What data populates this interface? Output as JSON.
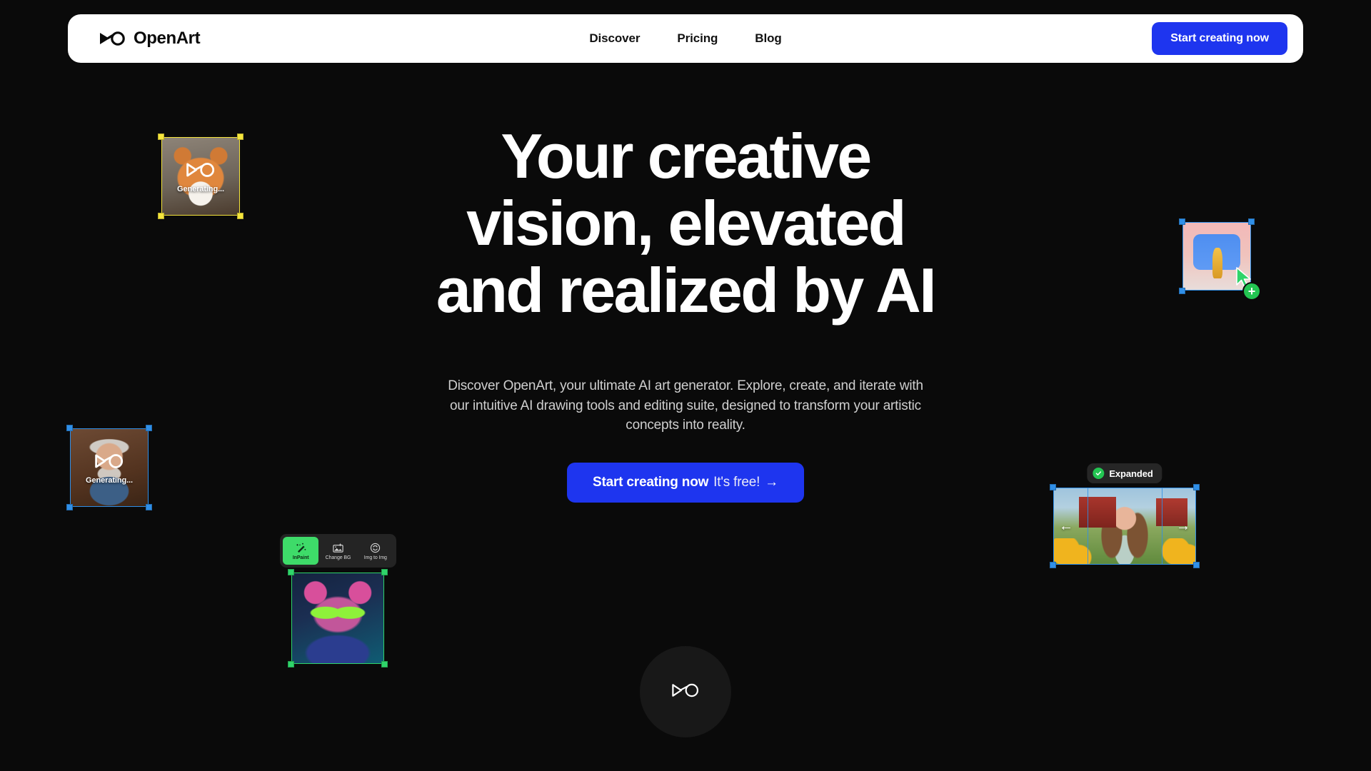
{
  "colors": {
    "background": "#0a0a0a",
    "header_bg": "#ffffff",
    "accent_blue": "#1e35ef",
    "accent_green": "#3edb69",
    "badge_green": "#23c552",
    "select_yellow": "#f5e53c",
    "select_blue": "#2f8fe8",
    "select_green": "#2fd46a"
  },
  "header": {
    "brand": "OpenArt",
    "logo_icon": "openart-infinity-icon",
    "nav": [
      {
        "label": "Discover"
      },
      {
        "label": "Pricing"
      },
      {
        "label": "Blog"
      }
    ],
    "cta_label": "Start creating now"
  },
  "hero": {
    "headline_line1": "Your creative",
    "headline_line2": "vision, elevated",
    "headline_line3": "and realized by AI",
    "subtitle": "Discover OpenArt, your ultimate AI art generator. Explore, create, and iterate with our intuitive AI drawing tools and editing suite, designed to transform your artistic concepts into reality.",
    "cta_bold": "Start creating now",
    "cta_light": "It's free!",
    "cta_arrow": "→"
  },
  "orb": {
    "icon": "openart-infinity-icon"
  },
  "cards": {
    "generating_cat": {
      "name": "generating-cat-card",
      "overlay_text": "Generating...",
      "overlay_icon": "openart-infinity-icon",
      "selection_color": "#f5e53c",
      "subject": "orange tabby cat"
    },
    "generating_man": {
      "name": "generating-old-man-card",
      "overlay_text": "Generating...",
      "overlay_icon": "openart-infinity-icon",
      "selection_color": "#2f8fe8",
      "subject": "elderly man 3d character"
    },
    "expand": {
      "name": "expand-canvas-card",
      "selection_color": "#2f8fe8",
      "cursor_icon": "cursor-arrow-icon",
      "plus_badge": "+",
      "subject": "image being outpainted"
    },
    "expanded": {
      "name": "expanded-result-card",
      "badge_label": "Expanded",
      "badge_icon": "check-circle-icon",
      "selection_color": "#2f8fe8",
      "arrow_left": "←",
      "arrow_right": "→",
      "subject": "girl with braids in farm scene"
    },
    "edit_tools": {
      "name": "edit-tools-card",
      "tools": [
        {
          "label": "InPaint",
          "icon": "magic-wand-icon",
          "active": true
        },
        {
          "label": "Change BG",
          "icon": "image-sparkle-icon",
          "active": false
        },
        {
          "label": "Img to Img",
          "icon": "refresh-circle-icon",
          "active": false
        }
      ]
    },
    "cyber_cat": {
      "name": "cyberpunk-cat-card",
      "selection_color": "#2fd46a",
      "subject": "cyberpunk cat with green glasses"
    }
  }
}
